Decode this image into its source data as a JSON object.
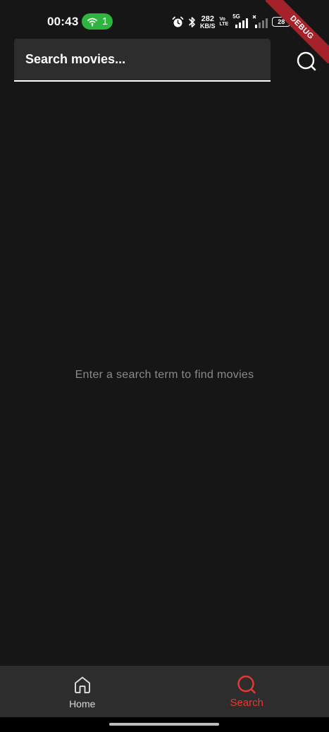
{
  "status_bar": {
    "time": "00:43",
    "hotspot_count": "1",
    "net_speed_value": "282",
    "net_speed_unit": "KB/S",
    "volte_top": "Vo",
    "volte_bottom": "LTE",
    "network_type": "5G",
    "battery_level": "28"
  },
  "debug_banner": {
    "label": "DEBUG",
    "color": "#a5222b"
  },
  "search": {
    "placeholder": "Search movies...",
    "value": "",
    "action_icon": "search-icon"
  },
  "main": {
    "empty_message": "Enter a search term to find movies"
  },
  "bottom_nav": {
    "items": [
      {
        "label": "Home",
        "icon": "home-icon",
        "active": false
      },
      {
        "label": "Search",
        "icon": "search-icon",
        "active": true
      }
    ],
    "active_color": "#e53935"
  },
  "colors": {
    "background": "#161616",
    "surface": "#2d2d2d",
    "hotspot": "#2fb53f"
  }
}
